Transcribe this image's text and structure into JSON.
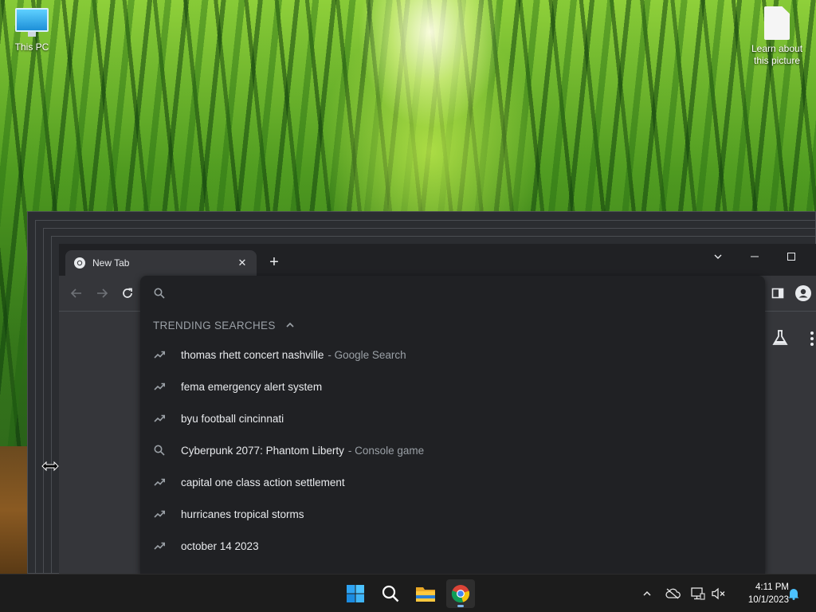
{
  "desktop": {
    "icons": [
      {
        "label": "This PC"
      },
      {
        "label": "Learn about this picture"
      }
    ]
  },
  "browser": {
    "tab": {
      "title": "New Tab"
    },
    "omnibox": {
      "value": "",
      "placeholder": ""
    },
    "dropdown": {
      "section_title": "TRENDING SEARCHES",
      "suggestions": [
        {
          "icon": "trending-icon",
          "text": "thomas rhett concert nashville",
          "description": "- Google Search"
        },
        {
          "icon": "trending-icon",
          "text": "fema emergency alert system",
          "description": ""
        },
        {
          "icon": "trending-icon",
          "text": "byu football cincinnati",
          "description": ""
        },
        {
          "icon": "search-icon",
          "text": "Cyberpunk 2077: Phantom Liberty",
          "description": "- Console game"
        },
        {
          "icon": "trending-icon",
          "text": "capital one class action settlement",
          "description": ""
        },
        {
          "icon": "trending-icon",
          "text": "hurricanes tropical storms",
          "description": ""
        },
        {
          "icon": "trending-icon",
          "text": "october 14 2023",
          "description": ""
        }
      ]
    }
  },
  "taskbar": {
    "clock": {
      "time": "4:11 PM",
      "date": "10/1/2023"
    }
  },
  "colors": {
    "accent": "#7fb6ea",
    "browser_bg": "#202124",
    "toolbar_bg": "#35363a",
    "text_primary": "#e8eaed",
    "text_secondary": "#9aa0a6"
  }
}
